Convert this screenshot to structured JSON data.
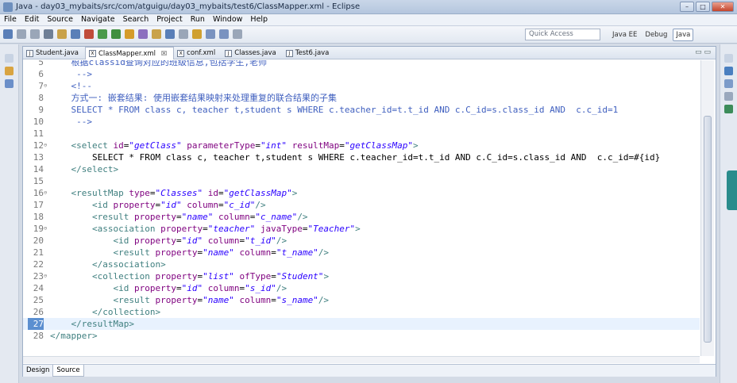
{
  "window": {
    "title": "Java - day03_mybaits/src/com/atguigu/day03_mybaits/test6/ClassMapper.xml - Eclipse"
  },
  "menu": [
    "File",
    "Edit",
    "Source",
    "Navigate",
    "Search",
    "Project",
    "Run",
    "Window",
    "Help"
  ],
  "toolbar": {
    "quick_access_placeholder": "Quick Access",
    "perspectives": [
      "Java EE",
      "Debug",
      "Java"
    ]
  },
  "tabs": [
    {
      "label": "Student.java",
      "icon": "J",
      "active": false
    },
    {
      "label": "ClassMapper.xml",
      "icon": "X",
      "active": true,
      "close": "☒"
    },
    {
      "label": "conf.xml",
      "icon": "X",
      "active": false
    },
    {
      "label": "Classes.java",
      "icon": "J",
      "active": false
    },
    {
      "label": "Test6.java",
      "icon": "J",
      "active": false
    }
  ],
  "code_lines": [
    {
      "n": "5",
      "html": "<span class='cmt'>    根据classid查询对应的班级信息,包括学生,老师</span>"
    },
    {
      "n": "6",
      "html": "<span class='cmt'>     --></span>"
    },
    {
      "n": "7",
      "fold": "⊖",
      "html": "<span class='cmt'>    &lt;!--</span>"
    },
    {
      "n": "8",
      "html": "<span class='cmt'>    方式一: 嵌套结果: 使用嵌套结果映射来处理重复的联合结果的子集</span>"
    },
    {
      "n": "9",
      "html": "<span class='cmt'>    SELECT * FROM class c, teacher t,student s WHERE c.teacher_id=t.t_id AND c.C_id=s.class_id AND  c.c_id=1</span>"
    },
    {
      "n": "10",
      "html": "<span class='cmt'>     --></span>"
    },
    {
      "n": "11",
      "html": ""
    },
    {
      "n": "12",
      "fold": "⊖",
      "html": "    <span class='tag'>&lt;select</span> <span class='attr'>id</span>=<span class='val'>\"getClass\"</span> <span class='attr'>parameterType</span>=<span class='val'>\"int\"</span> <span class='attr'>resultMap</span>=<span class='val'>\"getClassMap\"</span><span class='tag'>&gt;</span>"
    },
    {
      "n": "13",
      "html": "<span class='plain'>        SELECT * FROM class c, teacher t,student s WHERE c.teacher_id=t.t_id AND c.C_id=s.class_id AND  c.c_id=#{id}</span>"
    },
    {
      "n": "14",
      "html": "    <span class='tag'>&lt;/select&gt;</span>"
    },
    {
      "n": "15",
      "html": ""
    },
    {
      "n": "16",
      "fold": "⊖",
      "html": "    <span class='tag'>&lt;resultMap</span> <span class='attr'>type</span>=<span class='val'>\"Classes\"</span> <span class='attr'>id</span>=<span class='val'>\"getClassMap\"</span><span class='tag'>&gt;</span>"
    },
    {
      "n": "17",
      "html": "        <span class='tag'>&lt;id</span> <span class='attr'>property</span>=<span class='val'>\"id\"</span> <span class='attr'>column</span>=<span class='val'>\"c_id\"</span><span class='tag'>/&gt;</span>"
    },
    {
      "n": "18",
      "html": "        <span class='tag'>&lt;result</span> <span class='attr'>property</span>=<span class='val'>\"name\"</span> <span class='attr'>column</span>=<span class='val'>\"c_name\"</span><span class='tag'>/&gt;</span>"
    },
    {
      "n": "19",
      "fold": "⊖",
      "html": "        <span class='tag'>&lt;association</span> <span class='attr'>property</span>=<span class='val'>\"teacher\"</span> <span class='attr'>javaType</span>=<span class='val'>\"Teacher\"</span><span class='tag'>&gt;</span>"
    },
    {
      "n": "20",
      "html": "            <span class='tag'>&lt;id</span> <span class='attr'>property</span>=<span class='val'>\"id\"</span> <span class='attr'>column</span>=<span class='val'>\"t_id\"</span><span class='tag'>/&gt;</span>"
    },
    {
      "n": "21",
      "html": "            <span class='tag'>&lt;result</span> <span class='attr'>property</span>=<span class='val'>\"name\"</span> <span class='attr'>column</span>=<span class='val'>\"t_name\"</span><span class='tag'>/&gt;</span>"
    },
    {
      "n": "22",
      "html": "        <span class='tag'>&lt;/association&gt;</span>"
    },
    {
      "n": "23",
      "fold": "⊖",
      "html": "        <span class='tag'>&lt;collection</span> <span class='attr'>property</span>=<span class='val'>\"list\"</span> <span class='attr'>ofType</span>=<span class='val'>\"Student\"</span><span class='tag'>&gt;</span>"
    },
    {
      "n": "24",
      "html": "            <span class='tag'>&lt;id</span> <span class='attr'>property</span>=<span class='val'>\"id\"</span> <span class='attr'>column</span>=<span class='val'>\"s_id\"</span><span class='tag'>/&gt;</span>"
    },
    {
      "n": "25",
      "html": "            <span class='tag'>&lt;result</span> <span class='attr'>property</span>=<span class='val'>\"name\"</span> <span class='attr'>column</span>=<span class='val'>\"s_name\"</span><span class='tag'>/&gt;</span>"
    },
    {
      "n": "26",
      "html": "        <span class='tag'>&lt;/collection&gt;</span>"
    },
    {
      "n": "27",
      "current": true,
      "html": "    <span class='tag'>&lt;/resultMap&gt;</span>"
    },
    {
      "n": "28",
      "html": "<span class='tag'>&lt;/mapper&gt;</span>"
    }
  ],
  "bottom_tabs": [
    {
      "label": "Design",
      "active": false
    },
    {
      "label": "Source",
      "active": true
    }
  ]
}
